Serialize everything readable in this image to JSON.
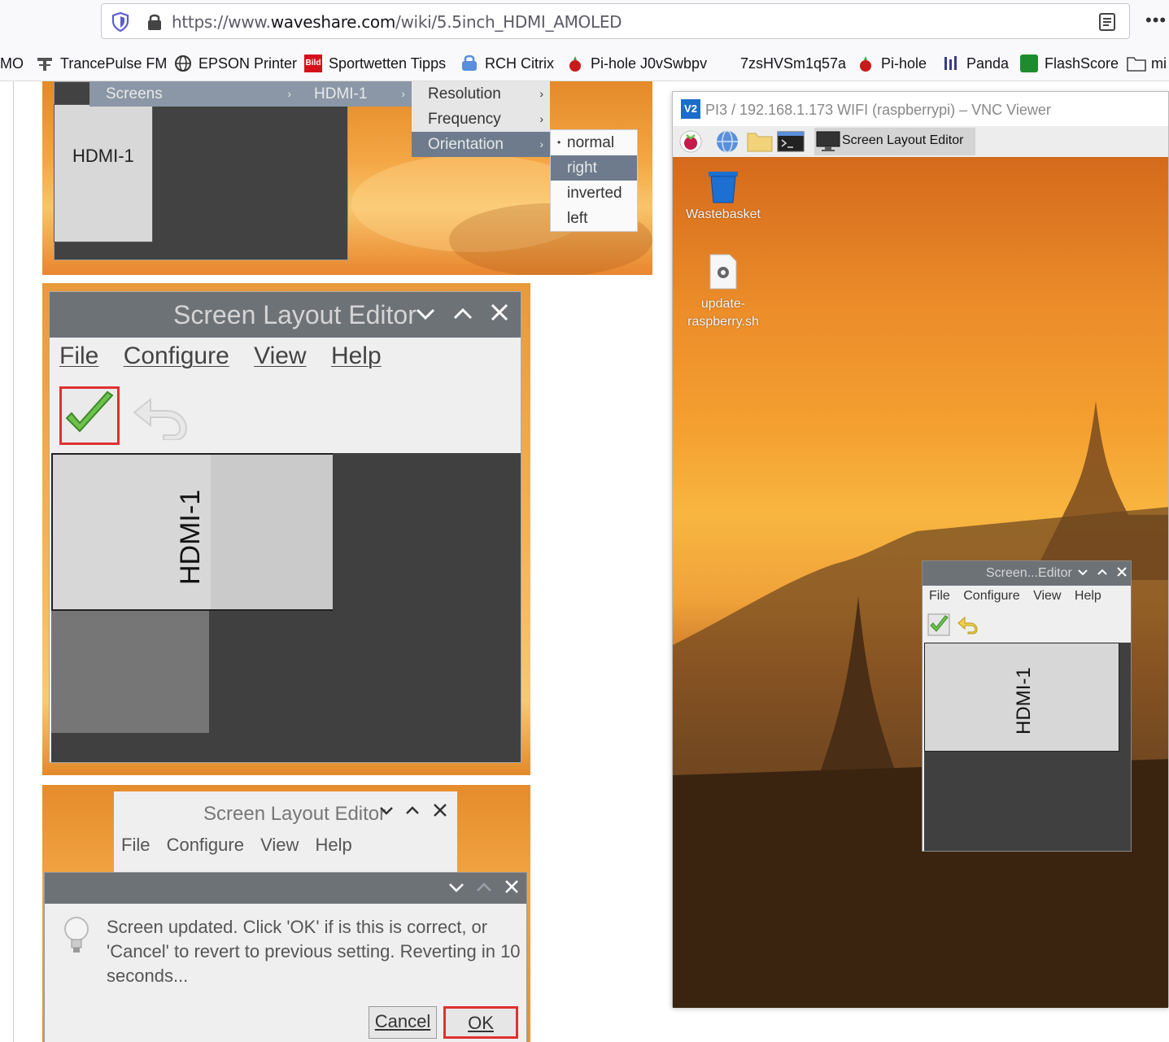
{
  "browser": {
    "url_prefix": "https://www.",
    "url_domain": "waveshare.com",
    "url_path": "/wiki/5.5inch_HDMI_AMOLED",
    "more_label": "•••"
  },
  "bookmarks": [
    {
      "label": "MO",
      "icon": "truncated-icon"
    },
    {
      "label": "TrancePulse FM",
      "icon": "radio-icon"
    },
    {
      "label": "EPSON Printer",
      "icon": "globe-icon"
    },
    {
      "label": "Sportwetten Tipps",
      "icon": "bild-logo-icon"
    },
    {
      "label": "RCH Citrix",
      "icon": "lock-badge-icon"
    },
    {
      "label": "Pi-hole J0vSwbpv",
      "icon": "pihole-icon"
    },
    {
      "label": "7zsHVSm1q57a",
      "icon": ""
    },
    {
      "label": "Pi-hole",
      "icon": "pihole-icon"
    },
    {
      "label": "Panda",
      "icon": "panda-icon"
    },
    {
      "label": "FlashScore",
      "icon": "flashscore-icon"
    },
    {
      "label": "mi",
      "icon": "folder-icon"
    }
  ],
  "img1": {
    "hdmi_label": "HDMI-1",
    "menu_screens": "Screens",
    "menu_hdmi": "HDMI-1",
    "menu_res": [
      "Resolution",
      "Frequency",
      "Orientation"
    ],
    "menu_orient": [
      "normal",
      "right",
      "inverted",
      "left"
    ],
    "arrow": "›",
    "bullet": "•"
  },
  "img2": {
    "title": "Screen Layout Editor",
    "menus": [
      "File",
      "Configure",
      "View",
      "Help"
    ],
    "hdmi_label": "HDMI-1",
    "ctrl_min": "⌄",
    "ctrl_max": "⌃",
    "ctrl_close": "✕"
  },
  "img3": {
    "title": "Screen Layout Editor",
    "menus": [
      "File",
      "Configure",
      "View",
      "Help"
    ],
    "message": "Screen updated. Click 'OK' if is this is correct, or 'Cancel' to revert to previous setting. Reverting in 10 seconds...",
    "cancel_label": "Cancel",
    "ok_label": "OK"
  },
  "vnc": {
    "logo": "V2",
    "title": "PI3 / 192.168.1.173 WIFI (raspberrypi) – VNC Viewer",
    "task_label": "Screen Layout Editor",
    "desktop_icons": [
      "Wastebasket",
      "update-",
      "raspberry.sh"
    ],
    "mini_title": "Screen...Editor",
    "mini_menus": [
      "File",
      "Configure",
      "View",
      "Help"
    ],
    "mini_hdmi_label": "HDMI-1"
  }
}
